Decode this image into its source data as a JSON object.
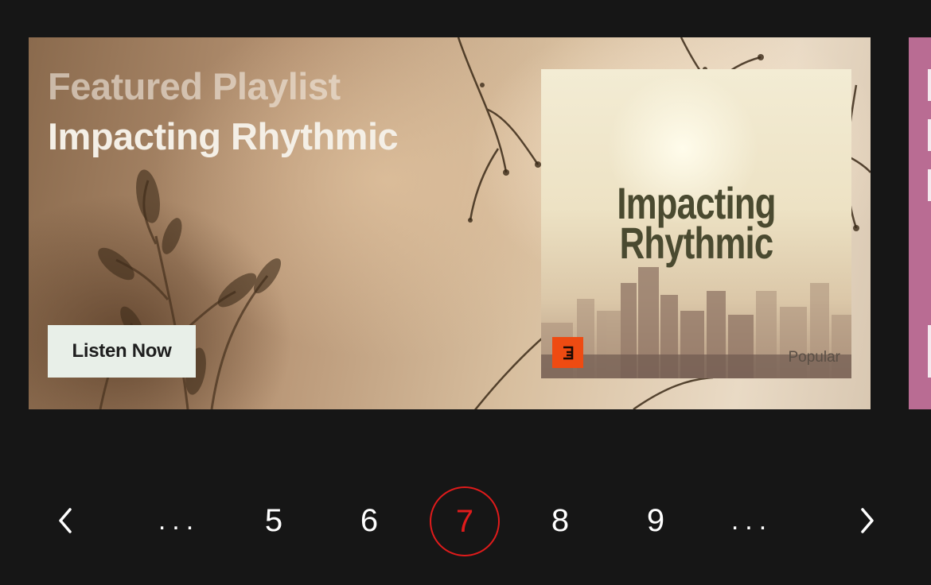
{
  "banner": {
    "eyebrow": "Featured Playlist",
    "title": "Impacting Rhythmic",
    "cta_label": "Listen Now",
    "cover": {
      "title_line1": "Impacting",
      "title_line2": "Rhythmic",
      "tag": "Popular",
      "badge_glyph": "3"
    }
  },
  "pagination": {
    "prev_icon": "chevron-left-icon",
    "next_icon": "chevron-right-icon",
    "leading_ellipsis": "...",
    "pages": [
      "5",
      "6",
      "7",
      "8",
      "9"
    ],
    "active_page": "7",
    "trailing_ellipsis": "...",
    "accent_color": "#e01b1b"
  },
  "colors": {
    "background": "#161616",
    "next_banner": "#b96c93",
    "button_bg": "#e8efe8",
    "badge": "#ee4b12"
  }
}
